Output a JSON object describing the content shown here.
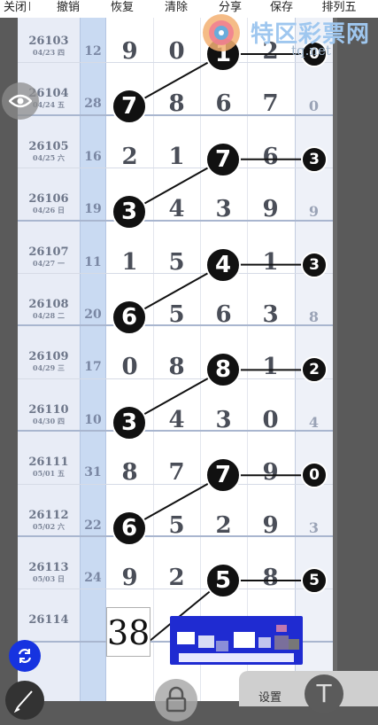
{
  "toolbar": {
    "items": [
      "关闭",
      "撤销",
      "恢复",
      "清除",
      "分享",
      "保存",
      "排列五"
    ]
  },
  "watermark": {
    "title": "特区彩票网",
    "url": "tq.net"
  },
  "rows": [
    {
      "issue": "26103",
      "date": "04/23 四",
      "sum": "12",
      "digits": [
        "9",
        "0",
        "1",
        "2"
      ],
      "last": "0"
    },
    {
      "issue": "26104",
      "date": "04/24 五",
      "sum": "28",
      "digits": [
        "7",
        "8",
        "6",
        "7"
      ],
      "last": "0"
    },
    {
      "issue": "26105",
      "date": "04/25 六",
      "sum": "16",
      "digits": [
        "2",
        "1",
        "7",
        "6"
      ],
      "last": "3"
    },
    {
      "issue": "26106",
      "date": "04/26 日",
      "sum": "19",
      "digits": [
        "3",
        "4",
        "3",
        "9"
      ],
      "last": "9"
    },
    {
      "issue": "26107",
      "date": "04/27 一",
      "sum": "11",
      "digits": [
        "1",
        "5",
        "4",
        "1"
      ],
      "last": "3"
    },
    {
      "issue": "26108",
      "date": "04/28 二",
      "sum": "20",
      "digits": [
        "6",
        "5",
        "6",
        "3"
      ],
      "last": "8"
    },
    {
      "issue": "26109",
      "date": "04/29 三",
      "sum": "17",
      "digits": [
        "0",
        "8",
        "8",
        "1"
      ],
      "last": "2"
    },
    {
      "issue": "26110",
      "date": "04/30 四",
      "sum": "10",
      "digits": [
        "3",
        "4",
        "3",
        "0"
      ],
      "last": "4"
    },
    {
      "issue": "26111",
      "date": "05/01 五",
      "sum": "31",
      "digits": [
        "8",
        "7",
        "7",
        "9"
      ],
      "last": "0"
    },
    {
      "issue": "26112",
      "date": "05/02 六",
      "sum": "22",
      "digits": [
        "6",
        "5",
        "2",
        "9"
      ],
      "last": "3"
    },
    {
      "issue": "26113",
      "date": "05/03 日",
      "sum": "24",
      "digits": [
        "9",
        "2",
        "5",
        "8"
      ],
      "last": "5"
    },
    {
      "issue": "26114",
      "date": "",
      "sum": "",
      "digits": [
        "",
        "",
        "",
        ""
      ],
      "last": ""
    }
  ],
  "prediction": "38",
  "settings": {
    "label": "设置",
    "t_label": "T"
  },
  "colors": {
    "ball": "#111111",
    "sum_column": "#c9daf2",
    "accent_button": "#1633e0"
  }
}
